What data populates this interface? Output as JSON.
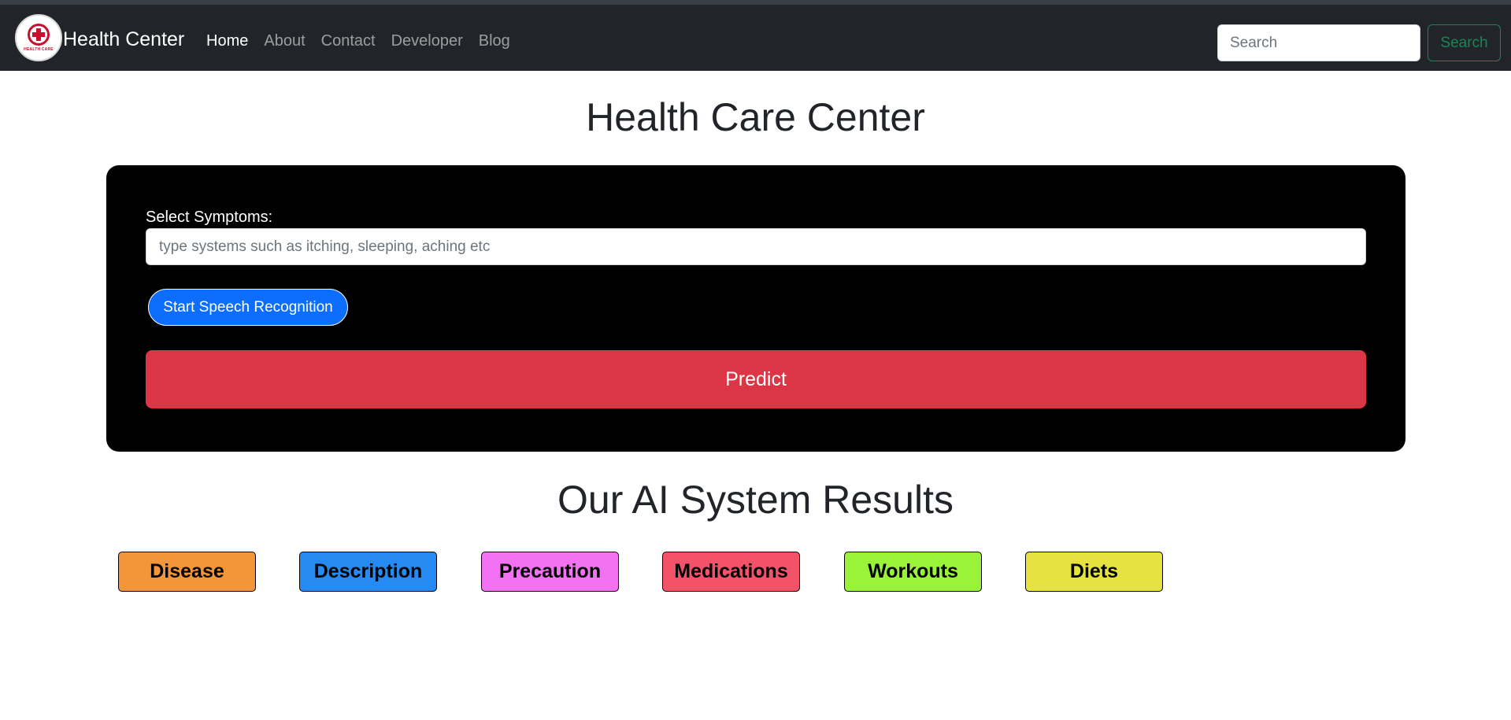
{
  "navbar": {
    "brand": "Health Center",
    "logo_text": "HEALTH CARE",
    "links": [
      {
        "label": "Home",
        "active": true
      },
      {
        "label": "About"
      },
      {
        "label": "Contact"
      },
      {
        "label": "Developer"
      },
      {
        "label": "Blog"
      }
    ],
    "search": {
      "placeholder": "Search",
      "value": "",
      "button_label": "Search"
    }
  },
  "page_title": "Health Care Center",
  "form": {
    "symptom_label": "Select Symptoms:",
    "symptom_placeholder": "type systems such as itching, sleeping, aching etc",
    "symptom_value": "",
    "speech_button_label": "Start Speech Recognition",
    "predict_button_label": "Predict"
  },
  "results": {
    "title": "Our AI System Results",
    "buttons": [
      {
        "label": "Disease",
        "color": "#F39539"
      },
      {
        "label": "Description",
        "color": "#268AF3"
      },
      {
        "label": "Precaution",
        "color": "#F371F3"
      },
      {
        "label": "Medications",
        "color": "#F35268"
      },
      {
        "label": "Workouts",
        "color": "#99F339"
      },
      {
        "label": "Diets",
        "color": "#E6E23F"
      }
    ]
  },
  "colors": {
    "navbar_bg": "#212529",
    "panel_bg": "#000000",
    "primary": "#0d6efd",
    "danger": "#dc3545",
    "success": "#198754"
  }
}
